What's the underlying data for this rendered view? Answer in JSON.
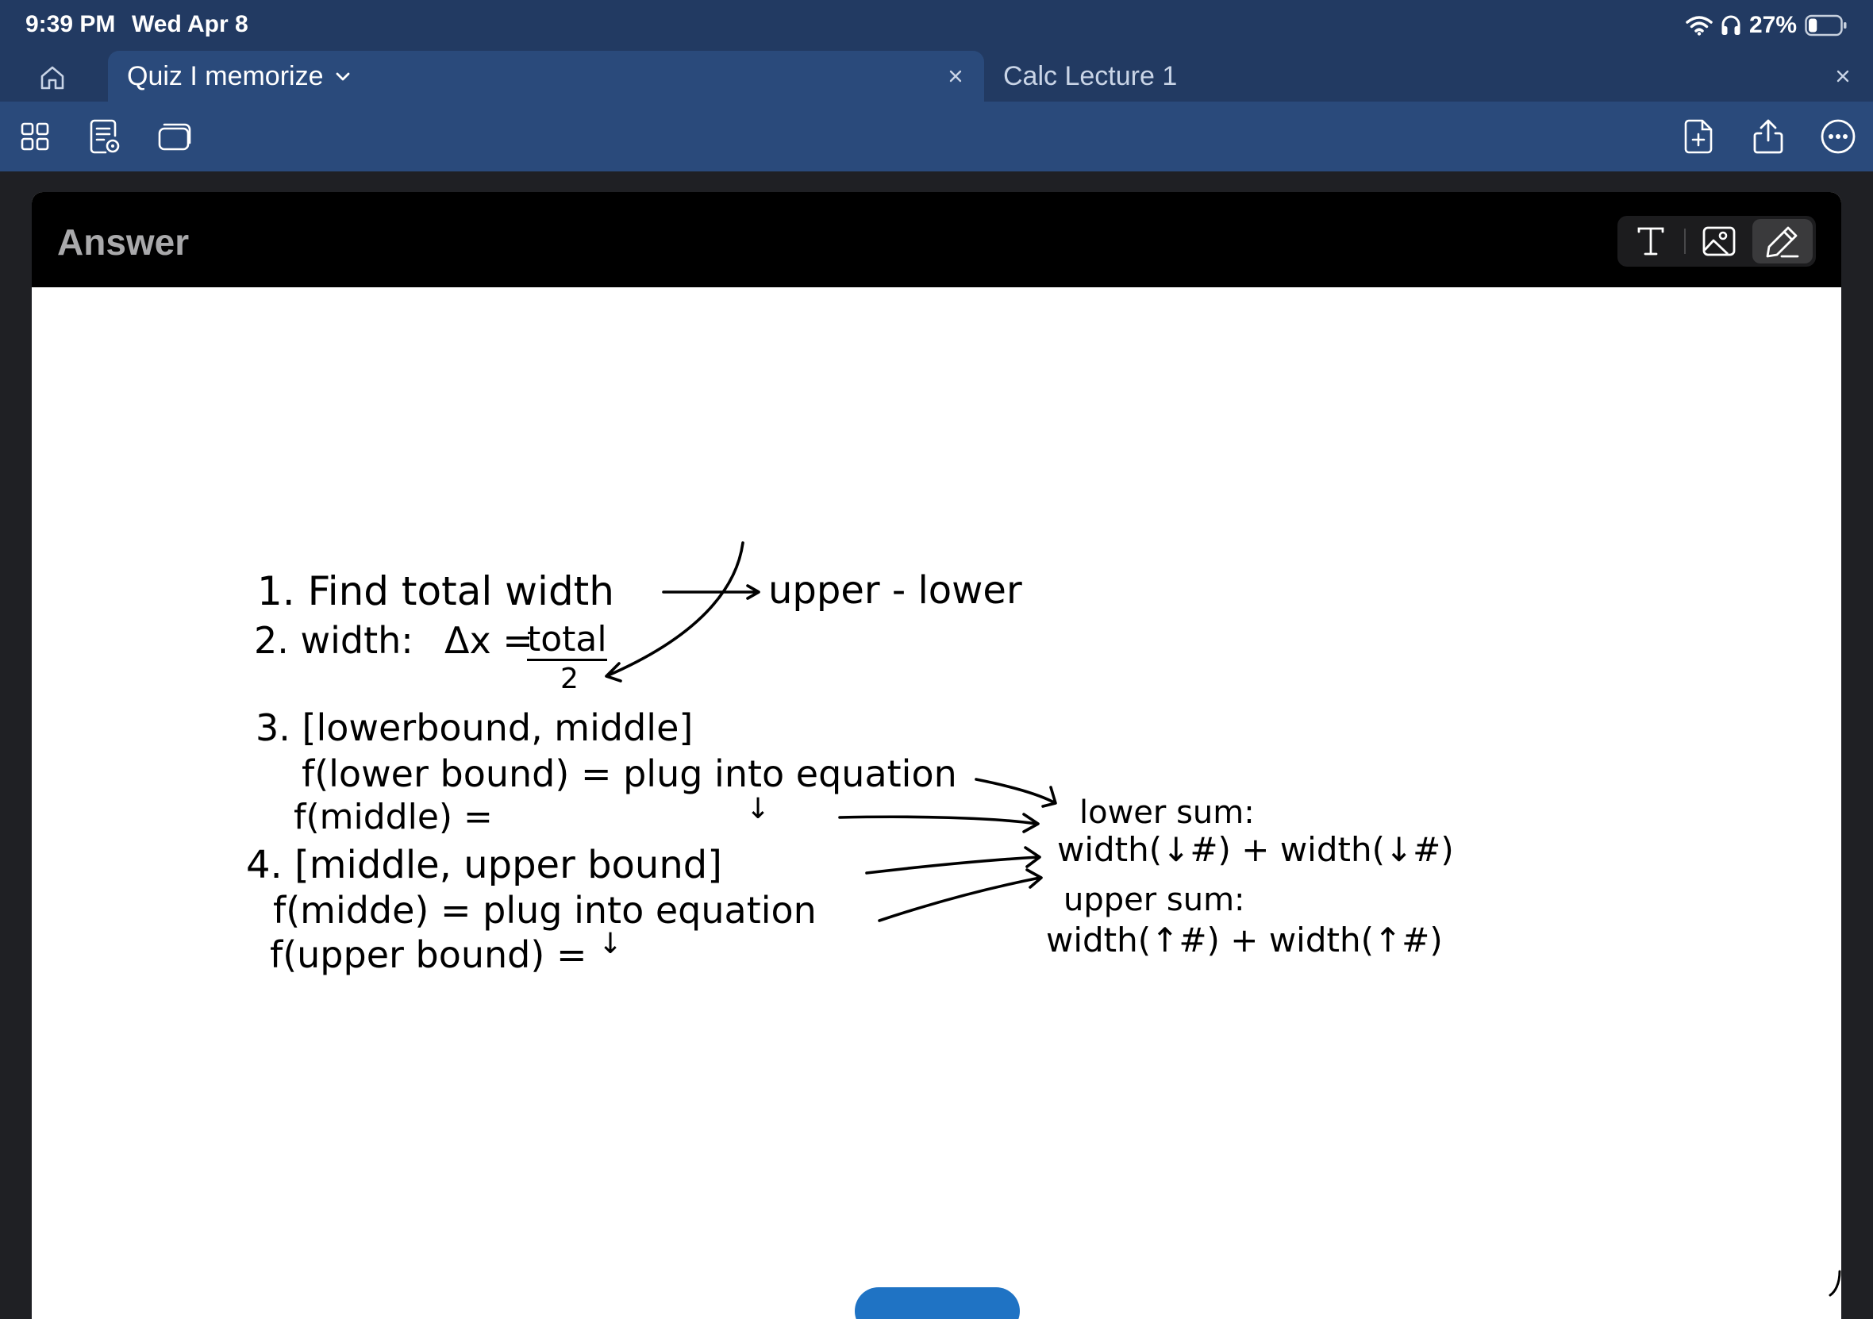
{
  "status_bar": {
    "time": "9:39 PM",
    "date": "Wed Apr 8",
    "battery": "27%",
    "battery_level": 0.27,
    "icons": [
      "wifi-icon",
      "headphones-icon",
      "battery-icon"
    ]
  },
  "tabs": [
    {
      "label": "Quiz I memorize",
      "active": true
    },
    {
      "label": "Calc Lecture 1",
      "active": false
    }
  ],
  "toolbar": {
    "left_icons": [
      "grid-icon",
      "document-settings-icon",
      "stack-icon"
    ],
    "right_icons": [
      "new-page-icon",
      "share-icon",
      "more-icon"
    ]
  },
  "card": {
    "title": "Answer",
    "modes": [
      "text-mode-icon",
      "image-mode-icon",
      "pen-mode-icon"
    ],
    "active_mode": "pen"
  },
  "notes": {
    "line1": "1. Find total width",
    "arrow1": "upper - lower",
    "line2_prefix": "2. width:",
    "line2_delta": "Δx =",
    "line2_numerator": "total",
    "line2_denominator": "2",
    "line3": "3. [lowerbound, middle]",
    "line3a": "f(lower bound) = plug into equation",
    "line3b": "f(middle) =",
    "line4": "4. [middle, upper bound]",
    "line4a": "f(midde) = plug into equation",
    "line4b": "f(upper bound) =",
    "down_arrow": "↓",
    "lower_sum_label": "lower sum:",
    "lower_sum_formula": "width(↓#) + width(↓#)",
    "upper_sum_label": "upper sum:",
    "upper_sum_formula": "width(↑#) + width(↑#)"
  },
  "colors": {
    "title_bar": "#223a62",
    "toolbar": "#2a4a7b",
    "card_header": "#000000",
    "canvas": "#ffffff",
    "accent_button": "#1f73c4"
  }
}
